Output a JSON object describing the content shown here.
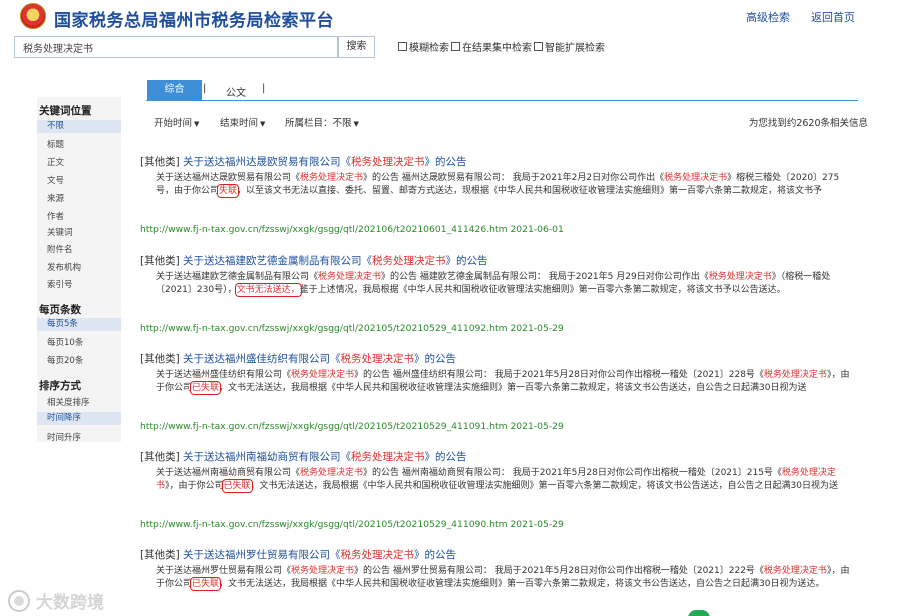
{
  "header": {
    "title": "国家税务总局福州市税务局检索平台",
    "advanced_search": "高级检索",
    "back_home": "返回首页"
  },
  "search": {
    "value": "税务处理决定书",
    "button": "搜索",
    "options": [
      "模糊检索",
      "在结果集中检索",
      "智能扩展检索"
    ]
  },
  "sidebar": {
    "sections": [
      {
        "title": "关键词位置",
        "items": [
          "不限",
          "标题",
          "正文",
          "文号",
          "来源",
          "作者",
          "关键词",
          "附件名",
          "发布机构",
          "索引号"
        ],
        "active": 0
      },
      {
        "title": "每页条数",
        "items": [
          "每页5条",
          "每页10条",
          "每页20条"
        ],
        "active": 0
      },
      {
        "title": "排序方式",
        "items": [
          "相关度排序",
          "时间降序",
          "时间升序"
        ],
        "active": 1
      }
    ]
  },
  "tabs": {
    "active": "综合",
    "other": "公文",
    "sep1": "|",
    "sep2": "|"
  },
  "filters": {
    "start": "开始时间",
    "end": "结束时间",
    "column": "所属栏目：不限"
  },
  "result_count": "为您找到约2620条相关信息",
  "results": [
    {
      "category": "[其他类]",
      "title_pre": "关于送达福州达晟欧贸易有限公司《",
      "title_kw": "税务处理决定书",
      "title_post": "》的公告",
      "snippet": [
        {
          "t": "关于送达福州达晟欧贸易有限公司《"
        },
        {
          "t": "税务处理决定书",
          "kw": true
        },
        {
          "t": "》的公告        福州达晟欧贸易有限公司：                 我局于2021年2月2日对你公司作出《"
        },
        {
          "t": "税务处理决定书",
          "kw": true
        },
        {
          "t": "》榕税三稽处〔2020〕275号，由于你公司"
        },
        {
          "t": "失联",
          "box": true
        },
        {
          "t": "，以至该文书无法以直接、委托、留置、邮寄方式送达，现根据《中华人民共和国税收征收管理法实施细则》第一百零六条第二款规定，将该文书予"
        }
      ],
      "url": "http://www.fj-n-tax.gov.cn/fzsswj/xxgk/gsgg/qtl/202106/t20210601_411426.htm",
      "date": "2021-06-01"
    },
    {
      "category": "[其他类]",
      "title_pre": "关于送达福建欧艺德金属制品有限公司《",
      "title_kw": "税务处理决定书",
      "title_post": "》的公告",
      "snippet": [
        {
          "t": "关于送达福建欧艺德金属制品有限公司《"
        },
        {
          "t": "税务处理决定书",
          "kw": true
        },
        {
          "t": "》的公告        福建欧艺德金属制品有限公司：                 我局于2021年5 月29日对你公司作出《"
        },
        {
          "t": "税务处理决定书",
          "kw": true
        },
        {
          "t": "》（榕税一稽处〔2021〕230号），"
        },
        {
          "t": "文书无法送达，",
          "box": true
        },
        {
          "t": "鉴于上述情况，我局根据《中华人民共和国税收征收管理法实施细则》第一百零六条第二款规定，将该文书予以公告送达。"
        }
      ],
      "url": "http://www.fj-n-tax.gov.cn/fzsswj/xxgk/gsgg/qtl/202105/t20210529_411092.htm",
      "date": "2021-05-29"
    },
    {
      "category": "[其他类]",
      "title_pre": "关于送达福州盛佳纺织有限公司《",
      "title_kw": "税务处理决定书",
      "title_post": "》的公告",
      "snippet": [
        {
          "t": "关于送达福州盛佳纺织有限公司《"
        },
        {
          "t": "税务处理决定书",
          "kw": true
        },
        {
          "t": "》的公告        福州盛佳纺织有限公司：                 我局于2021年5月28日对你公司作出榕税一稽处〔2021〕228号《"
        },
        {
          "t": "税务处理决定书",
          "kw": true
        },
        {
          "t": "》，由于你公司"
        },
        {
          "t": "已失联",
          "box": true
        },
        {
          "t": "，文书无法送达，我局根据《中华人民共和国税收征收管理法实施细则》第一百零六条第二款规定，将该文书公告送达，自公告之日起满30日视为送"
        }
      ],
      "url": "http://www.fj-n-tax.gov.cn/fzsswj/xxgk/gsgg/qtl/202105/t20210529_411091.htm",
      "date": "2021-05-29"
    },
    {
      "category": "[其他类]",
      "title_pre": "关于送达福州南福幼商贸有限公司《",
      "title_kw": "税务处理决定书",
      "title_post": "》的公告",
      "snippet": [
        {
          "t": "关于送达福州南福幼商贸有限公司《"
        },
        {
          "t": "税务处理决定书",
          "kw": true
        },
        {
          "t": "》的公告        福州南福幼商贸有限公司：                 我局于2021年5月28日对你公司作出榕税一稽处〔2021〕215号《"
        },
        {
          "t": "税务处理决定书",
          "kw": true
        },
        {
          "t": "》，由于你公司"
        },
        {
          "t": "已失联",
          "box": true
        },
        {
          "t": "，文书无法送达，我局根据《中华人民共和国税收征收管理法实施细则》第一百零六条第二款规定，将该文书公告送达，自公告之日起满30日视为送"
        }
      ],
      "url": "http://www.fj-n-tax.gov.cn/fzsswj/xxgk/gsgg/qtl/202105/t20210529_411090.htm",
      "date": "2021-05-29"
    },
    {
      "category": "[其他类]",
      "title_pre": "关于送达福州罗仕贸易有限公司《",
      "title_kw": "税务处理决定书",
      "title_post": "》的公告",
      "snippet": [
        {
          "t": "关于送达福州罗仕贸易有限公司《"
        },
        {
          "t": "税务处理决定书",
          "kw": true
        },
        {
          "t": "》的公告        福州罗仕贸易有限公司：                 我局于2021年5月28日对你公司作出榕税一稽处〔2021〕222号《"
        },
        {
          "t": "税务处理决定书",
          "kw": true
        },
        {
          "t": "》，由于你公司"
        },
        {
          "t": "已失联",
          "box": true
        },
        {
          "t": "，文书无法送达，我局根据《中华人民共和国税收征收管理法实施细则》第一百零六条第二款规定，将该文书公告送达，自公告之日起满30日视为送达。"
        }
      ]
    }
  ],
  "watermark": "大数跨境",
  "colors": {
    "link": "#1f4f9c",
    "keyword": "#e03030",
    "url": "#2a8a2a",
    "tab_active": "#3f8fd8",
    "sidebar_bg": "#f4f4f4"
  }
}
